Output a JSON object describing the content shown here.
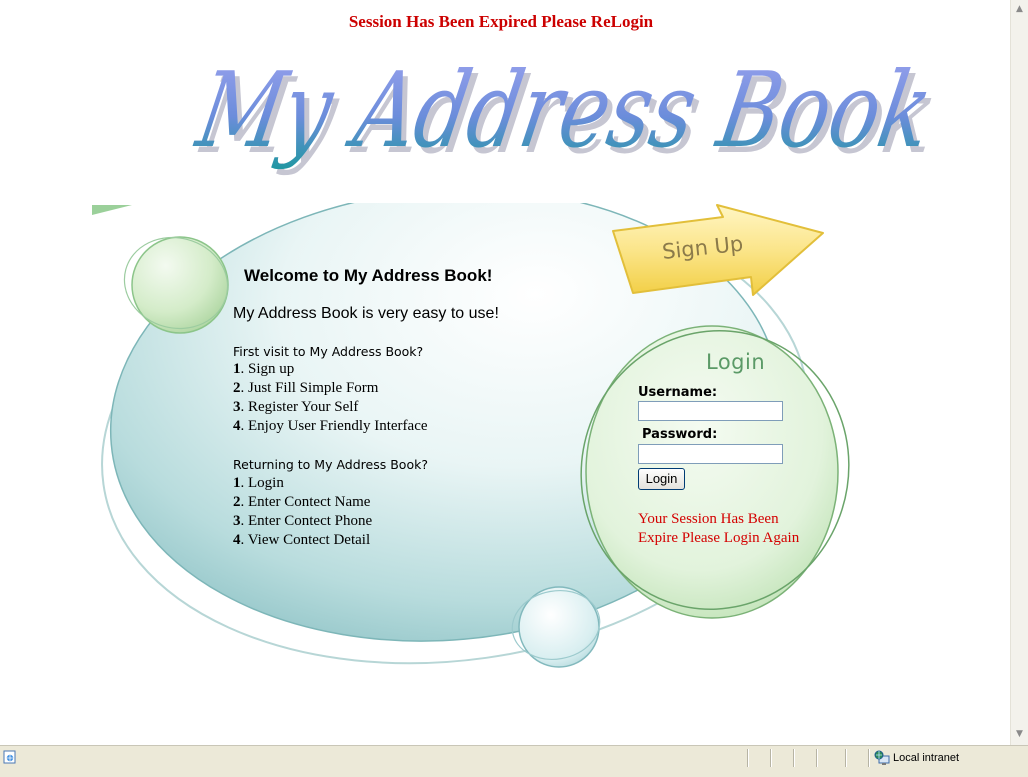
{
  "session_message": "Session Has Been Expired Please ReLogin",
  "logo_text": "My Address Book",
  "welcome": {
    "title": "Welcome to My Address Book!",
    "subtitle": "My Address Book is very easy to use!",
    "first_visit": {
      "question": "First visit to My Address Book?",
      "steps": [
        {
          "num": "1",
          "text": ". Sign up"
        },
        {
          "num": "2",
          "text": ". Just Fill Simple Form"
        },
        {
          "num": "3",
          "text": ". Register Your Self"
        },
        {
          "num": "4",
          "text": ". Enjoy User Friendly Interface"
        }
      ]
    },
    "returning": {
      "question": "Returning to My Address Book?",
      "steps": [
        {
          "num": "1",
          "text": ". Login"
        },
        {
          "num": "2",
          "text": ". Enter Contect Name"
        },
        {
          "num": "3",
          "text": ". Enter Contect Phone"
        },
        {
          "num": "4",
          "text": ". View Contect Detail"
        }
      ]
    }
  },
  "signup_button": "Sign Up",
  "login": {
    "title": "Login",
    "username_label": "Username:",
    "username_value": "",
    "password_label": "Password:",
    "password_value": "",
    "submit_label": "Login",
    "expire_message": "Your Session Has Been Expire Please Login Again"
  },
  "status_bar": {
    "zone": "Local intranet",
    "page_icon": "page-icon",
    "zone_icon": "globe-computer-icon"
  },
  "colors": {
    "alert_red": "#cc0000",
    "logo_blue": "#7f8fe0",
    "logo_teal": "#2f93a3",
    "login_green": "#5b9a67",
    "signup_yellow": "#f8de6a"
  }
}
